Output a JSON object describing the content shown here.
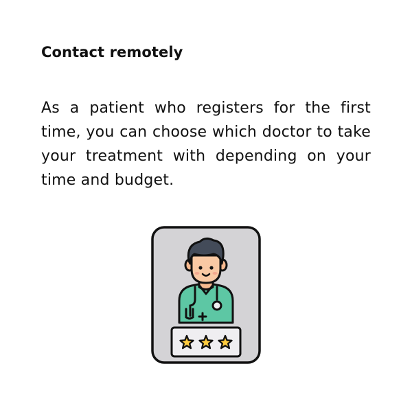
{
  "heading": "Contact remotely",
  "description": "As a patient who registers for the first time, you can choose which doctor to take your treatment with depending on your time and budget.",
  "illustration": {
    "icon": "doctor-rating-icon",
    "rating_stars": 3,
    "colors": {
      "card_background": "#d4d3d6",
      "outline": "#111111",
      "scrubs": "#5dc7a4",
      "skin": "#f9c9a4",
      "hair": "#434b59",
      "star": "#ffcc3f",
      "rating_panel": "#efeef1"
    }
  }
}
